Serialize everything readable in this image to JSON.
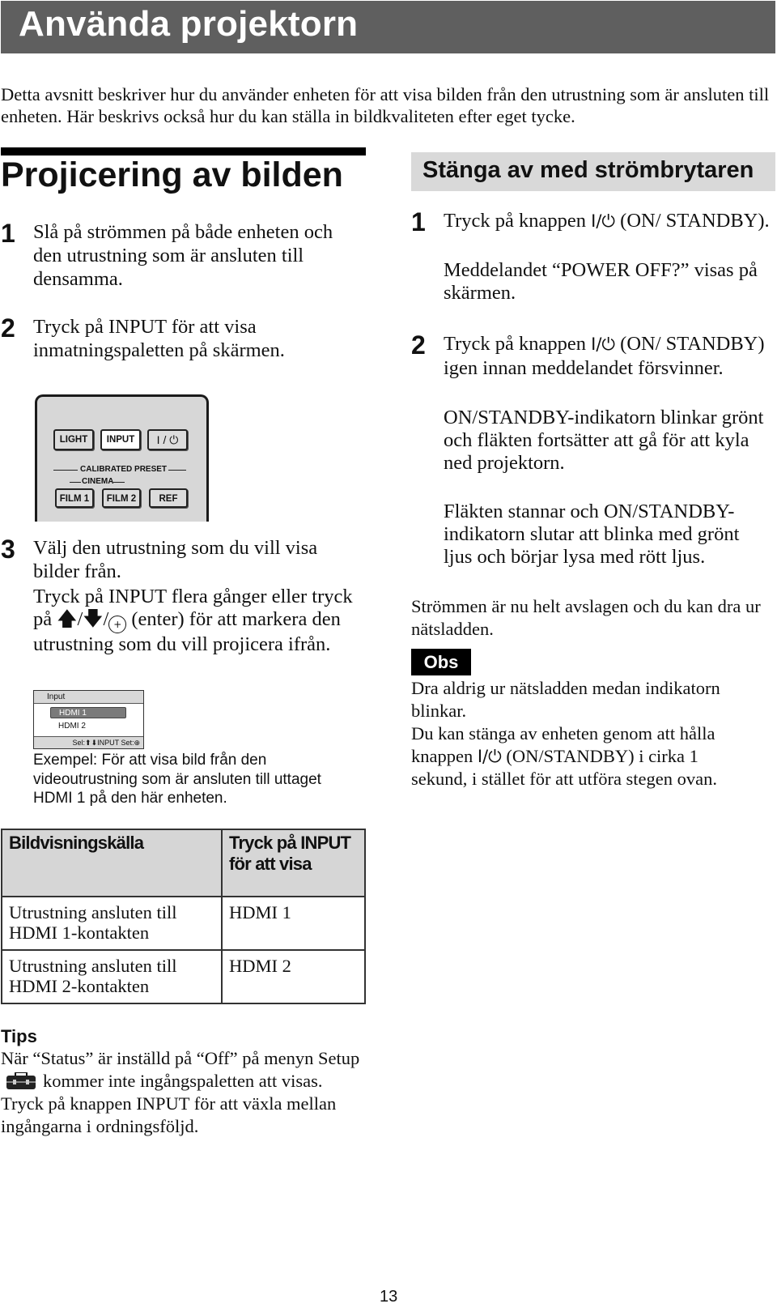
{
  "page": {
    "title": "Använda projektorn",
    "intro": "Detta avsnitt beskriver hur du använder enheten för att visa bilden från den utrustning som är ansluten till enheten. Här beskrivs också hur du kan ställa in bildkvaliteten efter eget tycke.",
    "page_number": "13"
  },
  "left": {
    "heading": "Projicering av bilden",
    "steps": [
      {
        "num": "1",
        "text": "Slå på strömmen på både enheten och den utrustning som är ansluten till densamma."
      },
      {
        "num": "2",
        "text": "Tryck på INPUT för att visa inmatningspaletten på skärmen."
      },
      {
        "num": "3",
        "text": "Välj den utrustning som du vill visa bilder från.",
        "detail_pre": "Tryck på INPUT flera gånger eller tryck på ",
        "detail_post": " (enter) för att markera den utrustning som du vill projicera ifrån.",
        "icons": [
          "arrow-up-icon",
          "arrow-down-icon",
          "enter-icon"
        ]
      }
    ],
    "remote": {
      "buttons": [
        "LIGHT",
        "INPUT",
        "I / ⏻",
        "FILM 1",
        "FILM 2",
        "REF"
      ],
      "group_label": "CALIBRATED PRESET",
      "subgroup_label": "CINEMA"
    },
    "palette": {
      "title": "Input",
      "options": [
        "HDMI 1",
        "HDMI 2"
      ],
      "selected": "HDMI 1",
      "footer": "Sel:⬆⬇INPUT  Set:⊕"
    },
    "caption": "Exempel: För att visa bild från den videoutrustning som är ansluten till uttaget HDMI 1 på den här enheten.",
    "table": {
      "headers": [
        "Bildvisningskälla",
        "Tryck på INPUT för att visa"
      ],
      "rows": [
        [
          "Utrustning ansluten till HDMI 1-kontakten",
          "HDMI 1"
        ],
        [
          "Utrustning ansluten till HDMI 2-kontakten",
          "HDMI 2"
        ]
      ]
    },
    "tips": {
      "label": "Tips",
      "text_pre": "När “Status” är inställd på “Off” på menyn Setup",
      "text_post": "kommer inte ingångspaletten att visas. Tryck på knappen INPUT för att växla mellan ingångarna i ordningsföljd.",
      "icon": "toolbox-icon"
    }
  },
  "right": {
    "heading": "Stänga av med strömbrytaren",
    "power_symbol": "I/⏻",
    "steps": [
      {
        "num": "1",
        "text_pre": "Tryck på knappen",
        "text_post": "(ON/ STANDBY).",
        "detail": "Meddelandet “POWER OFF?” visas på skärmen."
      },
      {
        "num": "2",
        "text_pre": "Tryck på knappen",
        "text_post": "(ON/ STANDBY) igen innan meddelandet försvinner.",
        "detail": "ON/STANDBY-indikatorn blinkar grönt och fläkten fortsätter att gå för att kyla ned projektorn.",
        "detail2": "Fläkten stannar och ON/STANDBY-indikatorn slutar att blinka med grönt ljus och börjar lysa med rött ljus."
      }
    ],
    "conclusion": "Strömmen är nu helt avslagen och du kan dra ur nätsladden.",
    "note_label": "Obs",
    "note_text1": "Dra aldrig ur nätsladden medan indikatorn blinkar.",
    "note_text2_pre": "Du kan stänga av enheten genom att hålla knappen",
    "note_text2_post": "(ON/STANDBY) i cirka 1 sekund, i stället för att utföra stegen ovan."
  }
}
